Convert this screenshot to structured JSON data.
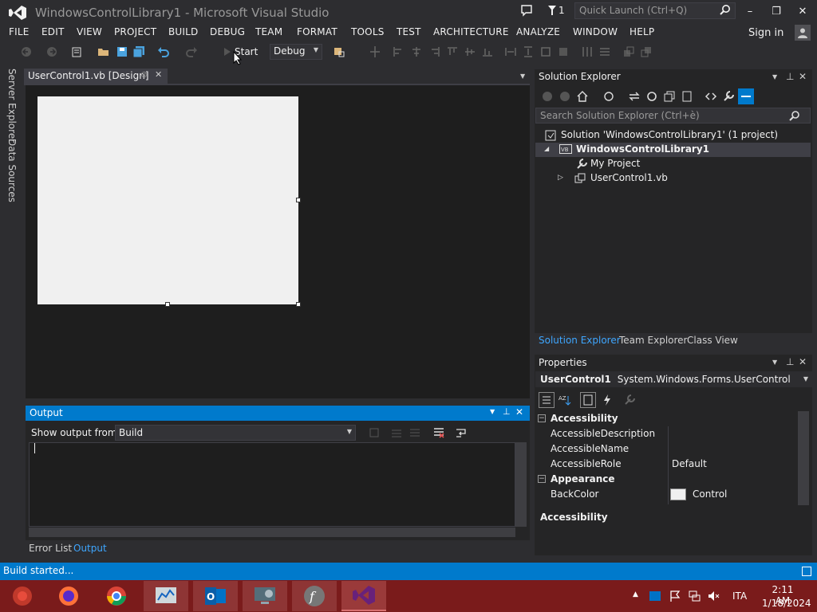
{
  "window": {
    "title": "WindowsControlLibrary1 - Microsoft Visual Studio",
    "notification_count": "1",
    "quick_launch_placeholder": "Quick Launch (Ctrl+Q)",
    "minimize": "–",
    "maximize": "❐",
    "close": "✕"
  },
  "menu": {
    "items": [
      "FILE",
      "EDIT",
      "VIEW",
      "PROJECT",
      "BUILD",
      "DEBUG",
      "TEAM",
      "FORMAT",
      "TOOLS",
      "TEST",
      "ARCHITECTURE",
      "ANALYZE",
      "WINDOW",
      "HELP"
    ],
    "sign_in": "Sign in"
  },
  "toolbar": {
    "start_label": "Start",
    "configuration": "Debug"
  },
  "side_tabs": {
    "server_explorer": "Server Explorer",
    "data_sources": "Data Sources"
  },
  "document": {
    "tab_label": "UserControl1.vb [Design]"
  },
  "output": {
    "title": "Output",
    "show_from_label": "Show output from:",
    "show_from_value": "Build",
    "tabs": [
      "Error List",
      "Output"
    ]
  },
  "solution_explorer": {
    "title": "Solution Explorer",
    "search_placeholder": "Search Solution Explorer (Ctrl+è)",
    "solution": "Solution 'WindowsControlLibrary1' (1 project)",
    "project": "WindowsControlLibrary1",
    "items": [
      "My Project",
      "UserControl1.vb"
    ],
    "bottom_tabs": [
      "Solution Explorer",
      "Team Explorer",
      "Class View"
    ]
  },
  "properties": {
    "title": "Properties",
    "object_name": "UserControl1",
    "object_type": "System.Windows.Forms.UserControl",
    "rows": [
      {
        "kind": "category",
        "name": "Accessibility"
      },
      {
        "kind": "prop",
        "name": "AccessibleDescription",
        "value": ""
      },
      {
        "kind": "prop",
        "name": "AccessibleName",
        "value": ""
      },
      {
        "kind": "prop",
        "name": "AccessibleRole",
        "value": "Default"
      },
      {
        "kind": "category",
        "name": "Appearance"
      },
      {
        "kind": "prop",
        "name": "BackColor",
        "value": "Control"
      }
    ],
    "description_title": "Accessibility",
    "backcolor_swatch": "#f0f0f0"
  },
  "status": {
    "text": "Build started..."
  },
  "tray": {
    "language": "ITA",
    "time": "2:11 AM",
    "date": "1/18/2024"
  },
  "colors": {
    "accent": "#007acc",
    "vs_purple": "#68217a",
    "taskbar": "#7a1b1b"
  }
}
